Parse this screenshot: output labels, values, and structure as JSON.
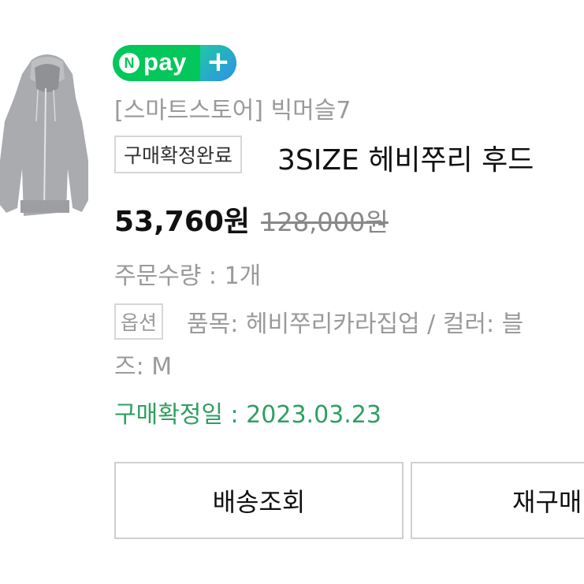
{
  "badge_logo": {
    "n_letter": "N",
    "pay_text": "pay",
    "plus": "+",
    "brand_color": "#03c75a"
  },
  "store": {
    "label": "[스마트스토어] 빅머슬7"
  },
  "order": {
    "status_badge": "구매확정완료",
    "product_title": "3SIZE 헤비쭈리 후드",
    "price": "53,760원",
    "original_price": "128,000원",
    "quantity": "주문수량 : 1개",
    "option_badge": "옵션",
    "option_text_line1": "품목: 헤비쭈리카라집업 / 컬러: 블",
    "option_text_line2": "즈: M",
    "confirm_date": "구매확정일 : 2023.03.23",
    "confirm_color": "#2e9f62"
  },
  "buttons": {
    "track_label": "배송조회",
    "reorder_label": "재구매"
  },
  "icons": {
    "thumbnail": "gray-zip-hoodie-image"
  }
}
